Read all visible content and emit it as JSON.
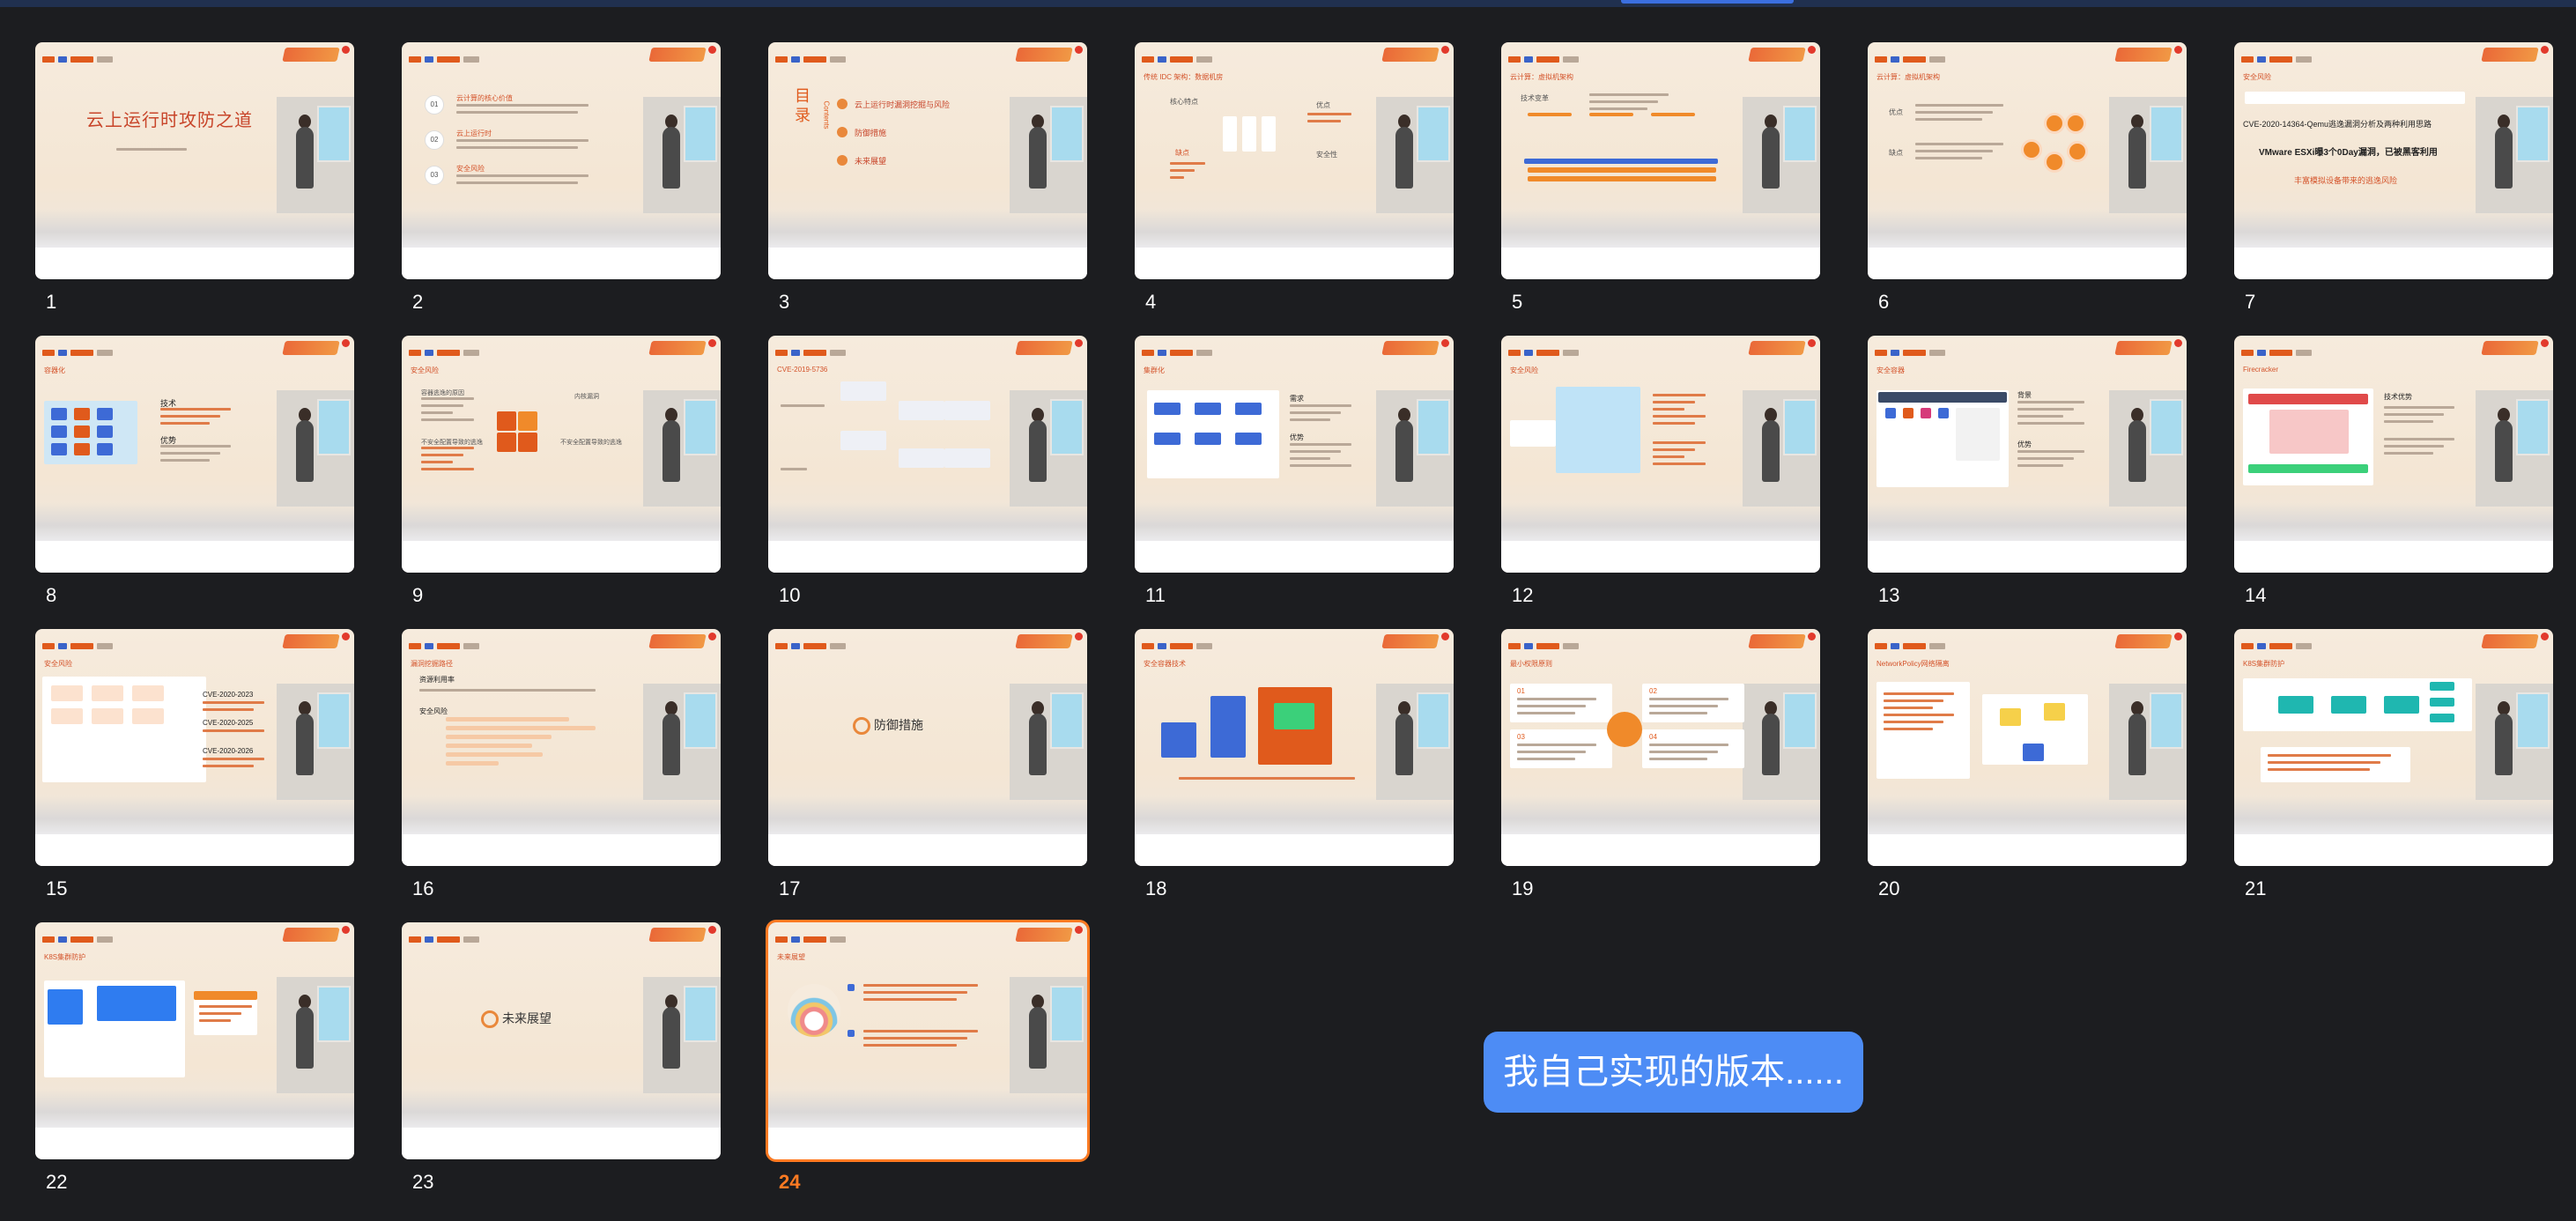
{
  "window": {
    "accent_color": "#ff7a22",
    "background_color": "#1c1d20"
  },
  "slides": [
    {
      "number": "1",
      "title": "云上运行时攻防之道",
      "subtitle": "",
      "section": ""
    },
    {
      "number": "2",
      "title": "",
      "section": "",
      "items": [
        "01",
        "02",
        "03"
      ],
      "labels": [
        "云计算的核心价值",
        "云上运行时",
        "安全风险"
      ]
    },
    {
      "number": "3",
      "title": "",
      "big": "目录",
      "side": "Contents",
      "items": [
        "云上运行时漏洞挖掘与风险",
        "防御措施",
        "未来展望"
      ]
    },
    {
      "number": "4",
      "title": "传统 IDC 架构：数据机房",
      "labels": [
        "核心特点",
        "优点",
        "缺点",
        "安全性"
      ]
    },
    {
      "number": "5",
      "title": "云计算：虚拟机架构",
      "labels": [
        "技术变革"
      ]
    },
    {
      "number": "6",
      "title": "云计算：虚拟机架构",
      "labels": [
        "优点",
        "缺点"
      ]
    },
    {
      "number": "7",
      "title": "安全风险",
      "labels": [
        "CVE-2020-14364-Qemu逃逸漏洞分析及两种利用思路",
        "VMware ESXi曝3个0Day漏洞，已被黑客利用",
        "丰富模拟设备带来的逃逸风险"
      ]
    },
    {
      "number": "8",
      "title": "容器化",
      "labels": [
        "技术",
        "优势"
      ]
    },
    {
      "number": "9",
      "title": "安全风险",
      "labels": [
        "容器逃逸的原因",
        "不安全配置导致的逃逸",
        "内核漏洞",
        "不安全配置导致的逃逸"
      ]
    },
    {
      "number": "10",
      "title": "CVE-2019-5736",
      "labels": []
    },
    {
      "number": "11",
      "title": "集群化",
      "labels": [
        "需求",
        "优势"
      ]
    },
    {
      "number": "12",
      "title": "安全风险",
      "labels": []
    },
    {
      "number": "13",
      "title": "安全容器",
      "labels": [
        "背景",
        "优势"
      ]
    },
    {
      "number": "14",
      "title": "Firecracker",
      "labels": [
        "技术优势"
      ]
    },
    {
      "number": "15",
      "title": "安全风险",
      "labels": [
        "CVE-2020-2023",
        "CVE-2020-2025",
        "CVE-2020-2026"
      ]
    },
    {
      "number": "16",
      "title": "漏洞挖掘路径",
      "labels": [
        "资源利用率",
        "安全风险"
      ]
    },
    {
      "number": "17",
      "title": "",
      "center": "防御措施"
    },
    {
      "number": "18",
      "title": "安全容器技术",
      "labels": []
    },
    {
      "number": "19",
      "title": "最小权限原则",
      "labels": [
        "01",
        "02",
        "03",
        "04"
      ]
    },
    {
      "number": "20",
      "title": "NetworkPolicy网络隔离",
      "labels": []
    },
    {
      "number": "21",
      "title": "K8S集群防护",
      "labels": []
    },
    {
      "number": "22",
      "title": "K8S集群防护",
      "labels": []
    },
    {
      "number": "23",
      "title": "",
      "center": "未来展望"
    },
    {
      "number": "24",
      "title": "未来展望",
      "labels": []
    }
  ],
  "selected_slide": "24",
  "overlay_caption": "我自己实现的版本......"
}
